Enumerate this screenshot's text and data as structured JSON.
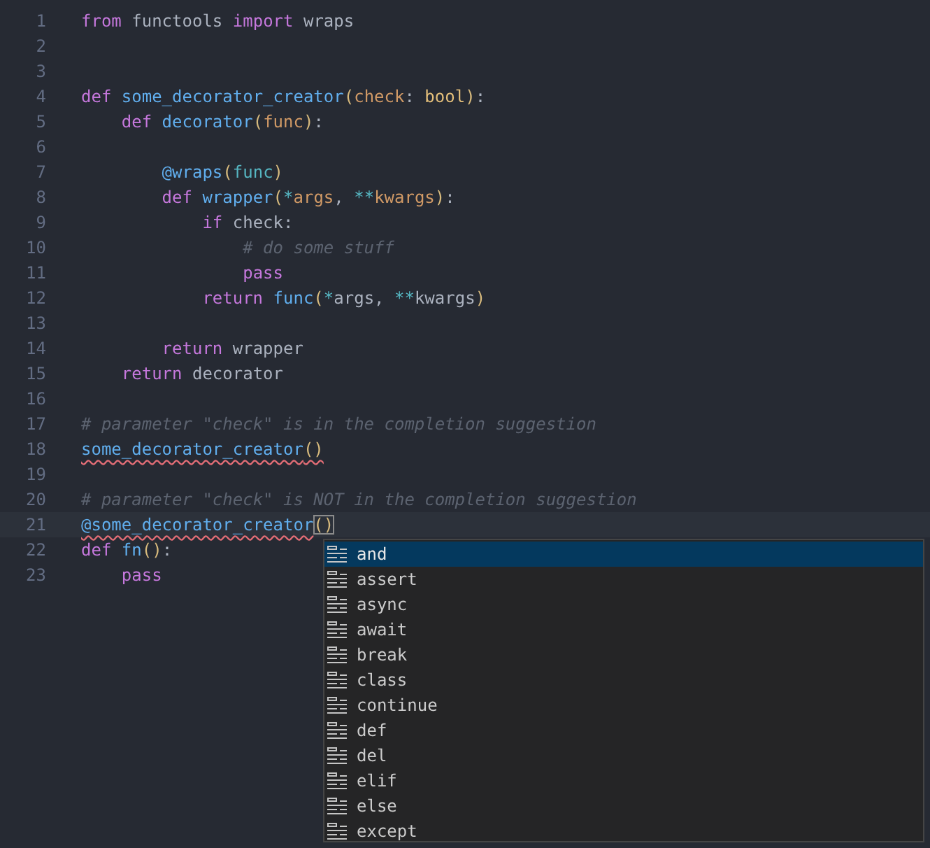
{
  "editor": {
    "lines": [
      {
        "number": "1",
        "tokens": [
          {
            "text": "from",
            "kind": "keyword"
          },
          {
            "text": " functools ",
            "kind": "plain"
          },
          {
            "text": "import",
            "kind": "keyword"
          },
          {
            "text": " wraps",
            "kind": "plain"
          }
        ]
      },
      {
        "number": "2"
      },
      {
        "number": "3"
      },
      {
        "number": "4",
        "tokens": [
          {
            "text": "def",
            "kind": "keyword"
          },
          {
            "text": " some_decorator_creator",
            "kind": "function"
          },
          {
            "text": "(",
            "kind": "bracket"
          },
          {
            "text": "check",
            "kind": "param"
          },
          {
            "text": ": ",
            "kind": "plain"
          },
          {
            "text": "bool",
            "kind": "type"
          },
          {
            "text": ")",
            "kind": "bracket"
          },
          {
            "text": ":",
            "kind": "plain"
          }
        ],
        "children": [
          {
            "number": "5",
            "tokens": [
              {
                "text": "def",
                "kind": "keyword"
              },
              {
                "text": " decorator",
                "kind": "function"
              },
              {
                "text": "(",
                "kind": "bracket"
              },
              {
                "text": "func",
                "kind": "param"
              },
              {
                "text": ")",
                "kind": "bracket"
              },
              {
                "text": ":",
                "kind": "plain"
              }
            ],
            "children": [
              {
                "number": "6"
              },
              {
                "number": "7",
                "tokens": [
                  {
                    "text": "@wraps",
                    "kind": "function"
                  },
                  {
                    "text": "(",
                    "kind": "bracket"
                  },
                  {
                    "text": "func",
                    "kind": "builtin"
                  },
                  {
                    "text": ")",
                    "kind": "bracket"
                  }
                ]
              },
              {
                "number": "8",
                "tokens": [
                  {
                    "text": "def",
                    "kind": "keyword"
                  },
                  {
                    "text": " wrapper",
                    "kind": "function"
                  },
                  {
                    "text": "(",
                    "kind": "bracket"
                  },
                  {
                    "text": "*",
                    "kind": "operator"
                  },
                  {
                    "text": "args",
                    "kind": "param"
                  },
                  {
                    "text": ", ",
                    "kind": "plain"
                  },
                  {
                    "text": "**",
                    "kind": "operator"
                  },
                  {
                    "text": "kwargs",
                    "kind": "param"
                  },
                  {
                    "text": ")",
                    "kind": "bracket"
                  },
                  {
                    "text": ":",
                    "kind": "plain"
                  }
                ],
                "children": [
                  {
                    "number": "9",
                    "tokens": [
                      {
                        "text": "if",
                        "kind": "keyword"
                      },
                      {
                        "text": " check:",
                        "kind": "plain"
                      }
                    ],
                    "children": [
                      {
                        "number": "10",
                        "tokens": [
                          {
                            "text": "# do some stuff",
                            "kind": "comment"
                          }
                        ]
                      },
                      {
                        "number": "11",
                        "tokens": [
                          {
                            "text": "pass",
                            "kind": "keyword"
                          }
                        ]
                      }
                    ]
                  },
                  {
                    "number": "12",
                    "tokens": [
                      {
                        "text": "return",
                        "kind": "keyword"
                      },
                      {
                        "text": " func",
                        "kind": "function"
                      },
                      {
                        "text": "(",
                        "kind": "bracket"
                      },
                      {
                        "text": "*",
                        "kind": "operator"
                      },
                      {
                        "text": "args, ",
                        "kind": "plain"
                      },
                      {
                        "text": "**",
                        "kind": "operator"
                      },
                      {
                        "text": "kwargs",
                        "kind": "plain"
                      },
                      {
                        "text": ")",
                        "kind": "bracket"
                      }
                    ]
                  }
                ]
              },
              {
                "number": "13"
              },
              {
                "number": "14",
                "tokens": [
                  {
                    "text": "return",
                    "kind": "keyword"
                  },
                  {
                    "text": " wrapper",
                    "kind": "plain"
                  }
                ]
              }
            ]
          },
          {
            "number": "15",
            "tokens": [
              {
                "text": "return",
                "kind": "keyword"
              },
              {
                "text": " decorator",
                "kind": "plain"
              }
            ]
          }
        ]
      },
      {
        "number": "16"
      },
      {
        "number": "17",
        "tokens": [
          {
            "text": "# parameter \"check\" is in the completion suggestion",
            "kind": "comment"
          }
        ]
      },
      {
        "number": "18",
        "tokens": [
          {
            "text": "some_decorator_creator",
            "kind": "function",
            "error": true
          },
          {
            "text": "()",
            "kind": "bracket",
            "error": true
          }
        ]
      },
      {
        "number": "19"
      },
      {
        "number": "20",
        "tokens": [
          {
            "text": "# parameter \"check\" is NOT in the completion suggestion",
            "kind": "comment"
          }
        ]
      },
      {
        "number": "21",
        "current": true,
        "tokens": [
          {
            "text": "@some_decorator_creator",
            "kind": "function",
            "error": true
          },
          {
            "text": "()",
            "kind": "bracket",
            "matched": true
          }
        ]
      },
      {
        "number": "22",
        "tokens": [
          {
            "text": "def",
            "kind": "keyword"
          },
          {
            "text": " fn",
            "kind": "function"
          },
          {
            "text": "()",
            "kind": "bracket"
          },
          {
            "text": ":",
            "kind": "plain"
          }
        ],
        "children": [
          {
            "number": "23",
            "tokens": [
              {
                "text": "pass",
                "kind": "keyword"
              }
            ]
          }
        ]
      }
    ]
  },
  "completion": {
    "items": [
      {
        "label": "and",
        "selected": true
      },
      {
        "label": "assert",
        "selected": false
      },
      {
        "label": "async",
        "selected": false
      },
      {
        "label": "await",
        "selected": false
      },
      {
        "label": "break",
        "selected": false
      },
      {
        "label": "class",
        "selected": false
      },
      {
        "label": "continue",
        "selected": false
      },
      {
        "label": "def",
        "selected": false
      },
      {
        "label": "del",
        "selected": false
      },
      {
        "label": "elif",
        "selected": false
      },
      {
        "label": "else",
        "selected": false
      },
      {
        "label": "except",
        "selected": false
      }
    ]
  }
}
